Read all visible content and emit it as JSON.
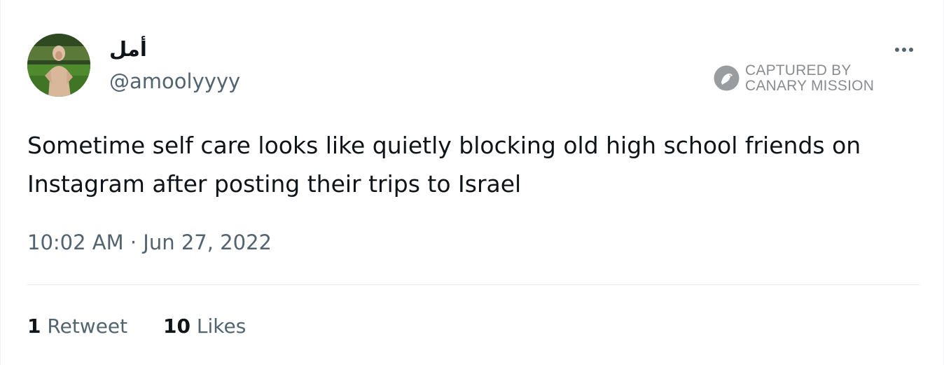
{
  "author": {
    "display_name": "أمل",
    "handle": "@amoolyyyy"
  },
  "watermark": {
    "line1": "CAPTURED BY",
    "line2": "CANARY MISSION",
    "icon": "canary-bird-icon"
  },
  "tweet": {
    "text": "Sometime self care looks like quietly blocking old high school friends on Instagram after posting their trips to Israel",
    "timestamp": "10:02 AM · Jun 27, 2022"
  },
  "stats": {
    "retweets_count": "1",
    "retweets_label": "Retweet",
    "likes_count": "10",
    "likes_label": "Likes"
  },
  "icons": {
    "more": "more-options-icon"
  },
  "colors": {
    "primary_text": "#0f1419",
    "secondary_text": "#536471",
    "divider": "#e6ecf0",
    "watermark": "#8a8d90"
  }
}
